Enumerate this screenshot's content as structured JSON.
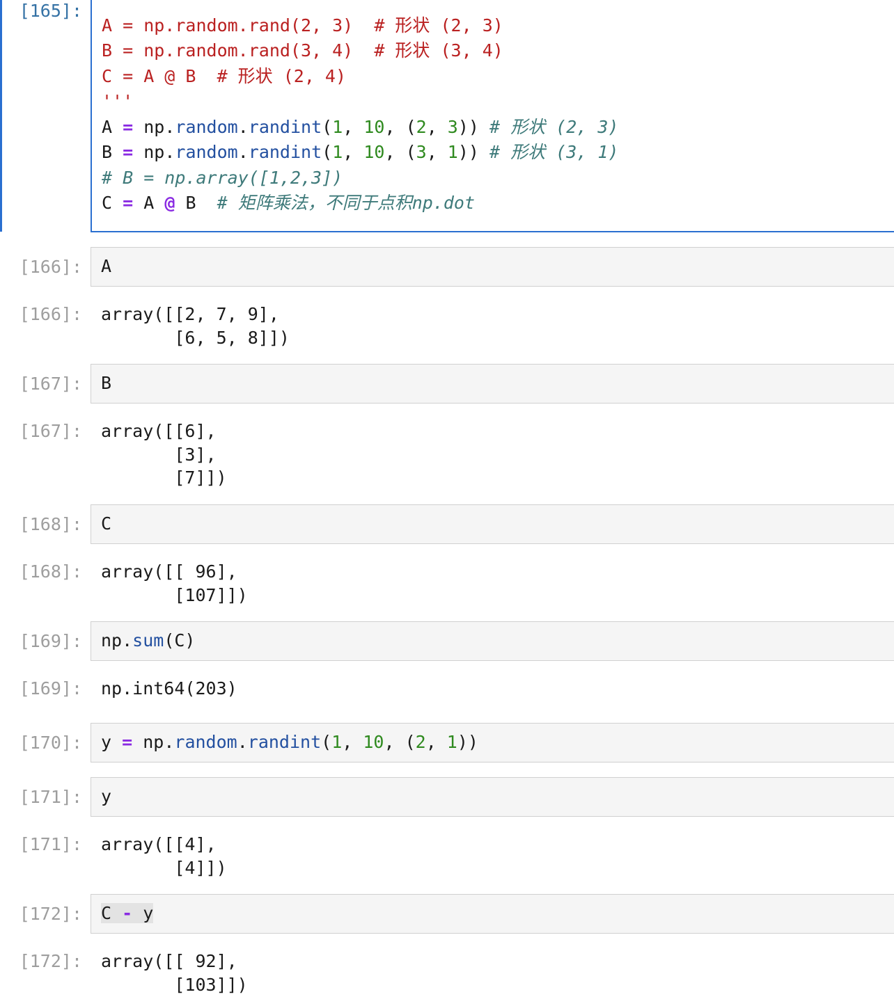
{
  "cells": [
    {
      "id": "c165",
      "in_prompt": "[165]:",
      "code_lines": [
        {
          "tokens": [
            {
              "t": "'''",
              "k": "s"
            }
          ]
        },
        {
          "tokens": [
            {
              "t": "A = np.random.rand(2, 3)  # 形状 (2, 3)",
              "k": "s"
            }
          ]
        },
        {
          "tokens": [
            {
              "t": "B = np.random.rand(3, 4)  # 形状 (3, 4)",
              "k": "s"
            }
          ]
        },
        {
          "tokens": [
            {
              "t": "C = A @ B  # 形状 (2, 4)",
              "k": "s"
            }
          ]
        },
        {
          "tokens": [
            {
              "t": "'''",
              "k": "s"
            }
          ]
        },
        {
          "tokens": [
            {
              "t": "A ",
              "k": ""
            },
            {
              "t": "=",
              "k": "o"
            },
            {
              "t": " np.",
              "k": ""
            },
            {
              "t": "random",
              "k": "f"
            },
            {
              "t": ".",
              "k": ""
            },
            {
              "t": "randint",
              "k": "f"
            },
            {
              "t": "(",
              "k": ""
            },
            {
              "t": "1",
              "k": "n"
            },
            {
              "t": ", ",
              "k": ""
            },
            {
              "t": "10",
              "k": "n"
            },
            {
              "t": ", (",
              "k": ""
            },
            {
              "t": "2",
              "k": "n"
            },
            {
              "t": ", ",
              "k": ""
            },
            {
              "t": "3",
              "k": "n"
            },
            {
              "t": ")) ",
              "k": ""
            },
            {
              "t": "# 形状 (2, 3)",
              "k": "c"
            }
          ]
        },
        {
          "tokens": [
            {
              "t": "B ",
              "k": ""
            },
            {
              "t": "=",
              "k": "o"
            },
            {
              "t": " np.",
              "k": ""
            },
            {
              "t": "random",
              "k": "f"
            },
            {
              "t": ".",
              "k": ""
            },
            {
              "t": "randint",
              "k": "f"
            },
            {
              "t": "(",
              "k": ""
            },
            {
              "t": "1",
              "k": "n"
            },
            {
              "t": ", ",
              "k": ""
            },
            {
              "t": "10",
              "k": "n"
            },
            {
              "t": ", (",
              "k": ""
            },
            {
              "t": "3",
              "k": "n"
            },
            {
              "t": ", ",
              "k": ""
            },
            {
              "t": "1",
              "k": "n"
            },
            {
              "t": ")) ",
              "k": ""
            },
            {
              "t": "# 形状 (3, 1)",
              "k": "c"
            }
          ]
        },
        {
          "tokens": [
            {
              "t": "# B = np.array([1,2,3])",
              "k": "c"
            }
          ]
        },
        {
          "tokens": [
            {
              "t": "C ",
              "k": ""
            },
            {
              "t": "=",
              "k": "o"
            },
            {
              "t": " A ",
              "k": ""
            },
            {
              "t": "@",
              "k": "o"
            },
            {
              "t": " B  ",
              "k": ""
            },
            {
              "t": "# 矩阵乘法，不同于点积np.dot",
              "k": "c"
            }
          ]
        }
      ],
      "out_prompt": "",
      "output_lines": []
    },
    {
      "id": "c166",
      "in_prompt": "[166]:",
      "code_lines": [
        {
          "tokens": [
            {
              "t": "A",
              "k": ""
            }
          ]
        }
      ],
      "out_prompt": "[166]:",
      "output_lines": [
        "array([[2, 7, 9],",
        "       [6, 5, 8]])"
      ]
    },
    {
      "id": "c167",
      "in_prompt": "[167]:",
      "code_lines": [
        {
          "tokens": [
            {
              "t": "B",
              "k": ""
            }
          ]
        }
      ],
      "out_prompt": "[167]:",
      "output_lines": [
        "array([[6],",
        "       [3],",
        "       [7]])"
      ]
    },
    {
      "id": "c168",
      "in_prompt": "[168]:",
      "code_lines": [
        {
          "tokens": [
            {
              "t": "C",
              "k": ""
            }
          ]
        }
      ],
      "out_prompt": "[168]:",
      "output_lines": [
        "array([[ 96],",
        "       [107]])"
      ]
    },
    {
      "id": "c169",
      "in_prompt": "[169]:",
      "code_lines": [
        {
          "tokens": [
            {
              "t": "np.",
              "k": ""
            },
            {
              "t": "sum",
              "k": "f"
            },
            {
              "t": "(C)",
              "k": ""
            }
          ]
        }
      ],
      "out_prompt": "[169]:",
      "output_lines": [
        "np.int64(203)"
      ]
    },
    {
      "id": "c170",
      "in_prompt": "[170]:",
      "code_lines": [
        {
          "tokens": [
            {
              "t": "y ",
              "k": ""
            },
            {
              "t": "=",
              "k": "o"
            },
            {
              "t": " np.",
              "k": ""
            },
            {
              "t": "random",
              "k": "f"
            },
            {
              "t": ".",
              "k": ""
            },
            {
              "t": "randint",
              "k": "f"
            },
            {
              "t": "(",
              "k": ""
            },
            {
              "t": "1",
              "k": "n"
            },
            {
              "t": ", ",
              "k": ""
            },
            {
              "t": "10",
              "k": "n"
            },
            {
              "t": ", (",
              "k": ""
            },
            {
              "t": "2",
              "k": "n"
            },
            {
              "t": ", ",
              "k": ""
            },
            {
              "t": "1",
              "k": "n"
            },
            {
              "t": "))",
              "k": ""
            }
          ]
        }
      ],
      "out_prompt": "",
      "output_lines": []
    },
    {
      "id": "c171",
      "in_prompt": "[171]:",
      "code_lines": [
        {
          "tokens": [
            {
              "t": "y",
              "k": ""
            }
          ]
        }
      ],
      "out_prompt": "[171]:",
      "output_lines": [
        "array([[4],",
        "       [4]])"
      ]
    },
    {
      "id": "c172",
      "in_prompt": "[172]:",
      "code_lines": [
        {
          "tokens": [
            {
              "t": "C ",
              "k": "hl"
            },
            {
              "t": "-",
              "k": "o hl"
            },
            {
              "t": " y",
              "k": "hl"
            }
          ]
        }
      ],
      "out_prompt": "[172]:",
      "output_lines": [
        "array([[ 92],",
        "       [103]])"
      ]
    }
  ]
}
